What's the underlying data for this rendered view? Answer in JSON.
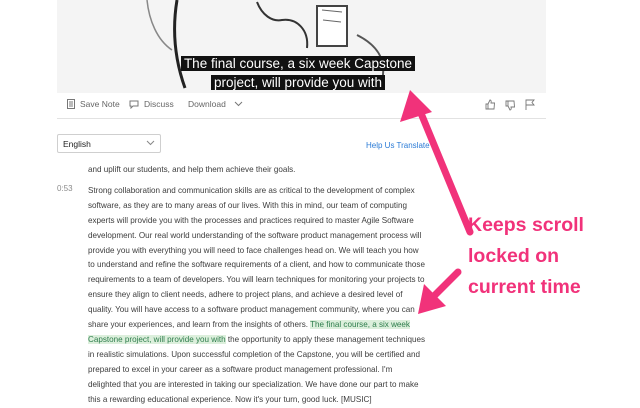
{
  "video": {
    "caption_line1": "The final course, a six week Capstone",
    "caption_line2": "project, will provide you with"
  },
  "toolbar": {
    "save_note": "Save Note",
    "discuss": "Discuss",
    "download": "Download"
  },
  "language": {
    "selected": "English"
  },
  "help_link": "Help Us Translate",
  "transcript": {
    "line0": "and uplift our students, and help them achieve their goals.",
    "timestamp": "0:53",
    "before": "Strong collaboration and communication skills are as critical to the development of complex software, as they are to many areas of our lives. With this in mind, our team of computing experts will provide you with the processes and practices required to master Agile Software development. Our real world understanding of the software product management process will provide you with everything you will need to face challenges head on. We will teach you how to understand and refine the software requirements of a client, and how to communicate those requirements to a team of developers. You will learn techniques for monitoring your projects to ensure they align to client needs, adhere to project plans, and achieve a desired level of quality. You will have access to a software product management community, where you can share your experiences, and learn from the insights of others. ",
    "highlight": "The final course, a six week Capstone project, will provide you with",
    "after": " the opportunity to apply these management techniques in realistic simulations. Upon successful completion of the Capstone, you will be certified and prepared to excel in your career as a software product management professional. I'm delighted that you are interested in taking our specialization. We have done our part to make this a rewarding educational experience. Now it's your turn, good luck. [MUSIC]"
  },
  "annotation": {
    "line1": "Keeps scroll",
    "line2": "locked on",
    "line3": "current time"
  },
  "colors": {
    "accent": "#f1327a",
    "highlight_bg": "#dcefdc",
    "link": "#2b7bd6"
  }
}
